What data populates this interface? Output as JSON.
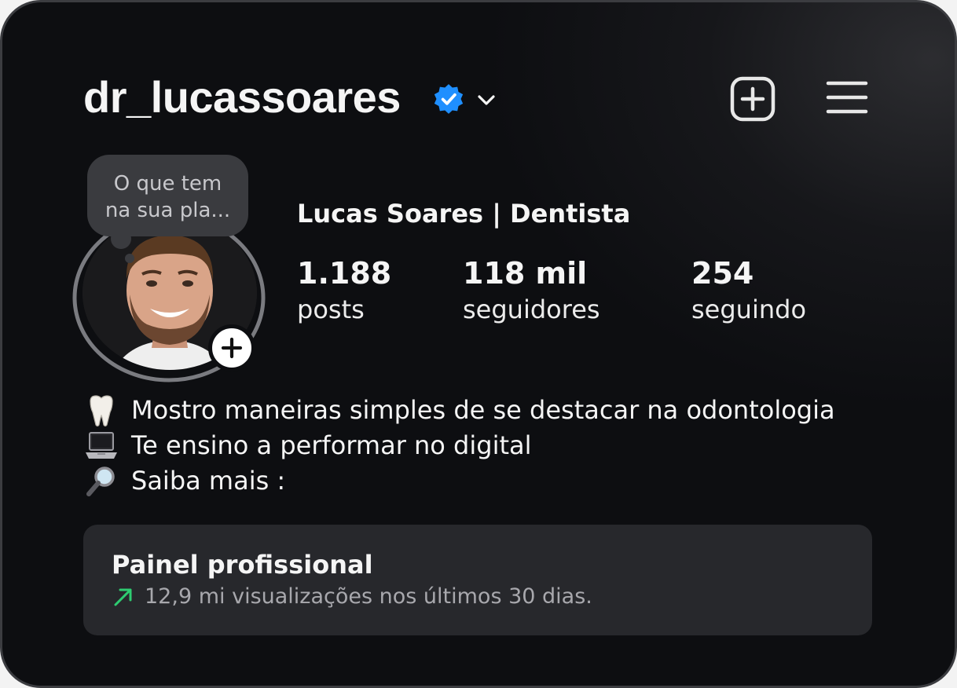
{
  "header": {
    "username": "dr_lucassoares",
    "verified": true,
    "accent_verified": "#1f8fff"
  },
  "note": {
    "text_line1": "O que tem",
    "text_line2": "na sua pla..."
  },
  "profile": {
    "display_name": "Lucas Soares | Dentista",
    "stats": [
      {
        "value": "1.188",
        "label": "posts"
      },
      {
        "value": "118 mil",
        "label": "seguidores"
      },
      {
        "value": "254",
        "label": "seguindo"
      }
    ]
  },
  "bio": {
    "lines": [
      {
        "icon": "tooth-icon",
        "text": "Mostro maneiras simples de se destacar na odontologia"
      },
      {
        "icon": "laptop-icon",
        "text": "Te ensino a performar no digital"
      },
      {
        "icon": "magnifier-icon",
        "text": "Saiba mais :"
      }
    ]
  },
  "dashboard": {
    "title": "Painel profissional",
    "subtitle": "12,9 mi visualizações nos últimos 30 dias.",
    "trend_color": "#2ecc71"
  },
  "icons": {
    "create": "plus-square-icon",
    "menu": "hamburger-menu-icon",
    "dropdown": "chevron-down-icon",
    "add_story": "plus-icon"
  }
}
